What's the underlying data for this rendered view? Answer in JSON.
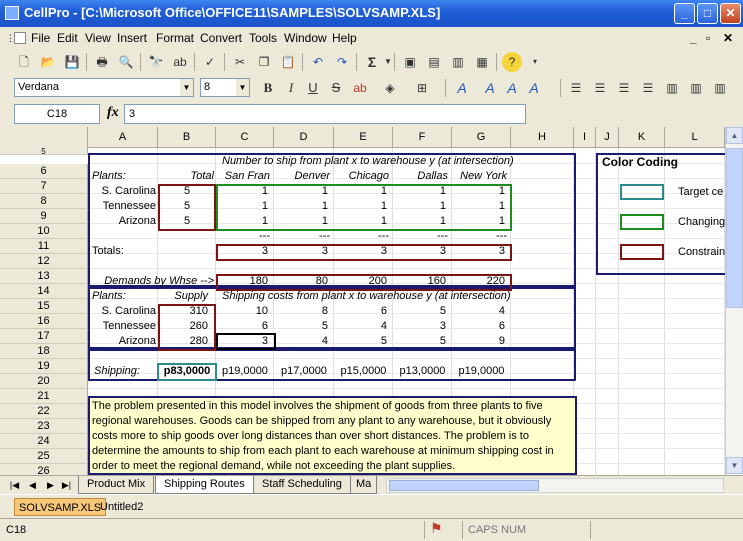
{
  "window": {
    "title": "CellPro - [C:\\Microsoft Office\\OFFICE11\\SAMPLES\\SOLVSAMP.XLS]",
    "min": "_",
    "max": "□",
    "close": "✕",
    "doc_min": "_",
    "doc_restore": "▫",
    "doc_close": "✕"
  },
  "menu": [
    "File",
    "Edit",
    "View",
    "Insert",
    "Format",
    "Convert",
    "Tools",
    "Window",
    "Help"
  ],
  "format_toolbar": {
    "font": "Verdana",
    "size": "8"
  },
  "formula_bar": {
    "name_box": "C18",
    "fx": "fx",
    "value": "3"
  },
  "columns": [
    "A",
    "B",
    "C",
    "D",
    "E",
    "F",
    "G",
    "H",
    "I",
    "J",
    "K",
    "L"
  ],
  "rows": [
    "5",
    "6",
    "7",
    "8",
    "9",
    "10",
    "11",
    "12",
    "13",
    "14",
    "15",
    "16",
    "17",
    "18",
    "19",
    "20",
    "21",
    "22",
    "23",
    "24",
    "25",
    "26"
  ],
  "sheet": {
    "header_ship": "Number to ship from plant x to warehouse y (at intersection)",
    "plants_label": "Plants:",
    "total_label": "Total",
    "warehouses": [
      "San Fran",
      "Denver",
      "Chicago",
      "Dallas",
      "New York"
    ],
    "plants": [
      "S. Carolina",
      "Tennessee",
      "Arizona"
    ],
    "totals": [
      "5",
      "5",
      "5"
    ],
    "ship_rows": [
      [
        "1",
        "1",
        "1",
        "1",
        "1"
      ],
      [
        "1",
        "1",
        "1",
        "1",
        "1"
      ],
      [
        "1",
        "1",
        "1",
        "1",
        "1"
      ]
    ],
    "dashes": [
      "---",
      "---",
      "---",
      "---",
      "---"
    ],
    "totals_label": "Totals:",
    "totals_row": [
      "3",
      "3",
      "3",
      "3",
      "3"
    ],
    "demands_label": "Demands by Whse -->",
    "demands": [
      "180",
      "80",
      "200",
      "160",
      "220"
    ],
    "plants_label2": "Plants:",
    "supply_label": "Supply",
    "cost_header": "Shipping costs from plant x to warehouse y (at intersection)",
    "supply": [
      "310",
      "260",
      "280"
    ],
    "cost_rows": [
      [
        "10",
        "8",
        "6",
        "5",
        "4"
      ],
      [
        "6",
        "5",
        "4",
        "3",
        "6"
      ],
      [
        "3",
        "4",
        "5",
        "5",
        "9"
      ]
    ],
    "shipping_label": "Shipping:",
    "shipping_total": "p83,0000",
    "shipping_costs": [
      "p19,0000",
      "p17,0000",
      "p15,0000",
      "p13,0000",
      "p19,0000"
    ],
    "description": "The problem presented in this model involves the shipment of goods from three plants to five regional warehouses.  Goods can be shipped from any plant to any warehouse, but it obviously costs more to ship goods over long distances than over short distances.  The problem is to determine the amounts to ship from each plant to each warehouse at minimum shipping cost in order to meet the regional demand, while not exceeding the plant supplies.",
    "legend_title": "Color Coding",
    "legend": [
      "Target ce",
      "Changing",
      "Constrain"
    ]
  },
  "colors": {
    "navy": "#1a1a6e",
    "teal": "#2e8b8b",
    "green": "#1e8c1e",
    "maroon": "#7b1414",
    "note_bg": "#ffffcc"
  },
  "sheet_tabs": [
    "Product Mix",
    "Shipping Routes",
    "Staff Scheduling",
    "Ma"
  ],
  "doc_tabs": [
    "SOLVSAMP.XLS",
    "Untitled2"
  ],
  "status": {
    "cell": "C18",
    "mode": "CAPS NUM"
  }
}
